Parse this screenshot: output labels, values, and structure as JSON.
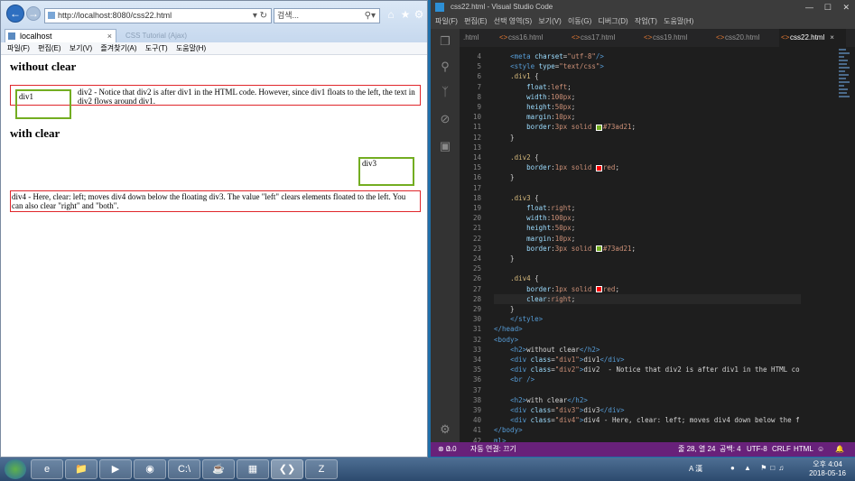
{
  "ie": {
    "url": "http://localhost:8080/css22.html",
    "search_placeholder": "검색...",
    "tab_title": "localhost",
    "ghost_tab": "CSS Tutorial (Ajax)",
    "menu": [
      "파일(F)",
      "편집(E)",
      "보기(V)",
      "즐겨찾기(A)",
      "도구(T)",
      "도움말(H)"
    ],
    "page": {
      "h2_1": "without clear",
      "div1": "div1",
      "div2": "div2 - Notice that div2 is after div1 in the HTML code. However, since div1 floats to the left, the text in div2 flows around div1.",
      "h2_2": "with clear",
      "div3": "div3",
      "div4": "div4 - Here, clear: left; moves div4 down below the floating div3. The value \"left\" clears elements floated to the left. You can also clear \"right\" and \"both\"."
    }
  },
  "vscode": {
    "title": "css22.html - Visual Studio Code",
    "menu": [
      "파일(F)",
      "편집(E)",
      "선택 영역(S)",
      "보기(V)",
      "이동(G)",
      "디버그(D)",
      "작업(T)",
      "도움말(H)"
    ],
    "tabs": [
      ".html",
      "css16.html",
      "css17.html",
      "css19.html",
      "css20.html",
      "css22.html"
    ],
    "active_tab_index": 5,
    "line_numbers": [
      "4",
      "5",
      "6",
      "7",
      "8",
      "9",
      "10",
      "11",
      "12",
      "13",
      "14",
      "15",
      "16",
      "17",
      "18",
      "19",
      "20",
      "21",
      "22",
      "23",
      "24",
      "25",
      "26",
      "27",
      "28",
      "29",
      "30",
      "31",
      "32",
      "33",
      "34",
      "35",
      "36",
      "37",
      "38",
      "39",
      "40",
      "41",
      "42"
    ],
    "status": {
      "errors": "0",
      "warnings": "0",
      "server": "자동 연결: 끄기",
      "position": "줄 28, 열 24",
      "spaces": "공백: 4",
      "encoding": "UTF-8",
      "eol": "CRLF",
      "language": "HTML"
    },
    "colors": {
      "accent": "#68217a",
      "green": "#73ad21",
      "red": "#ff0000"
    }
  },
  "taskbar": {
    "apps": [
      "ie-icon",
      "explorer-icon",
      "media-player-icon",
      "chrome-icon",
      "cmd-icon",
      "java-icon",
      "app-icon",
      "vscode-icon",
      "filezilla-icon"
    ],
    "time": "오후 4:04",
    "date": "2018-05-16",
    "ime": "A 漢"
  }
}
